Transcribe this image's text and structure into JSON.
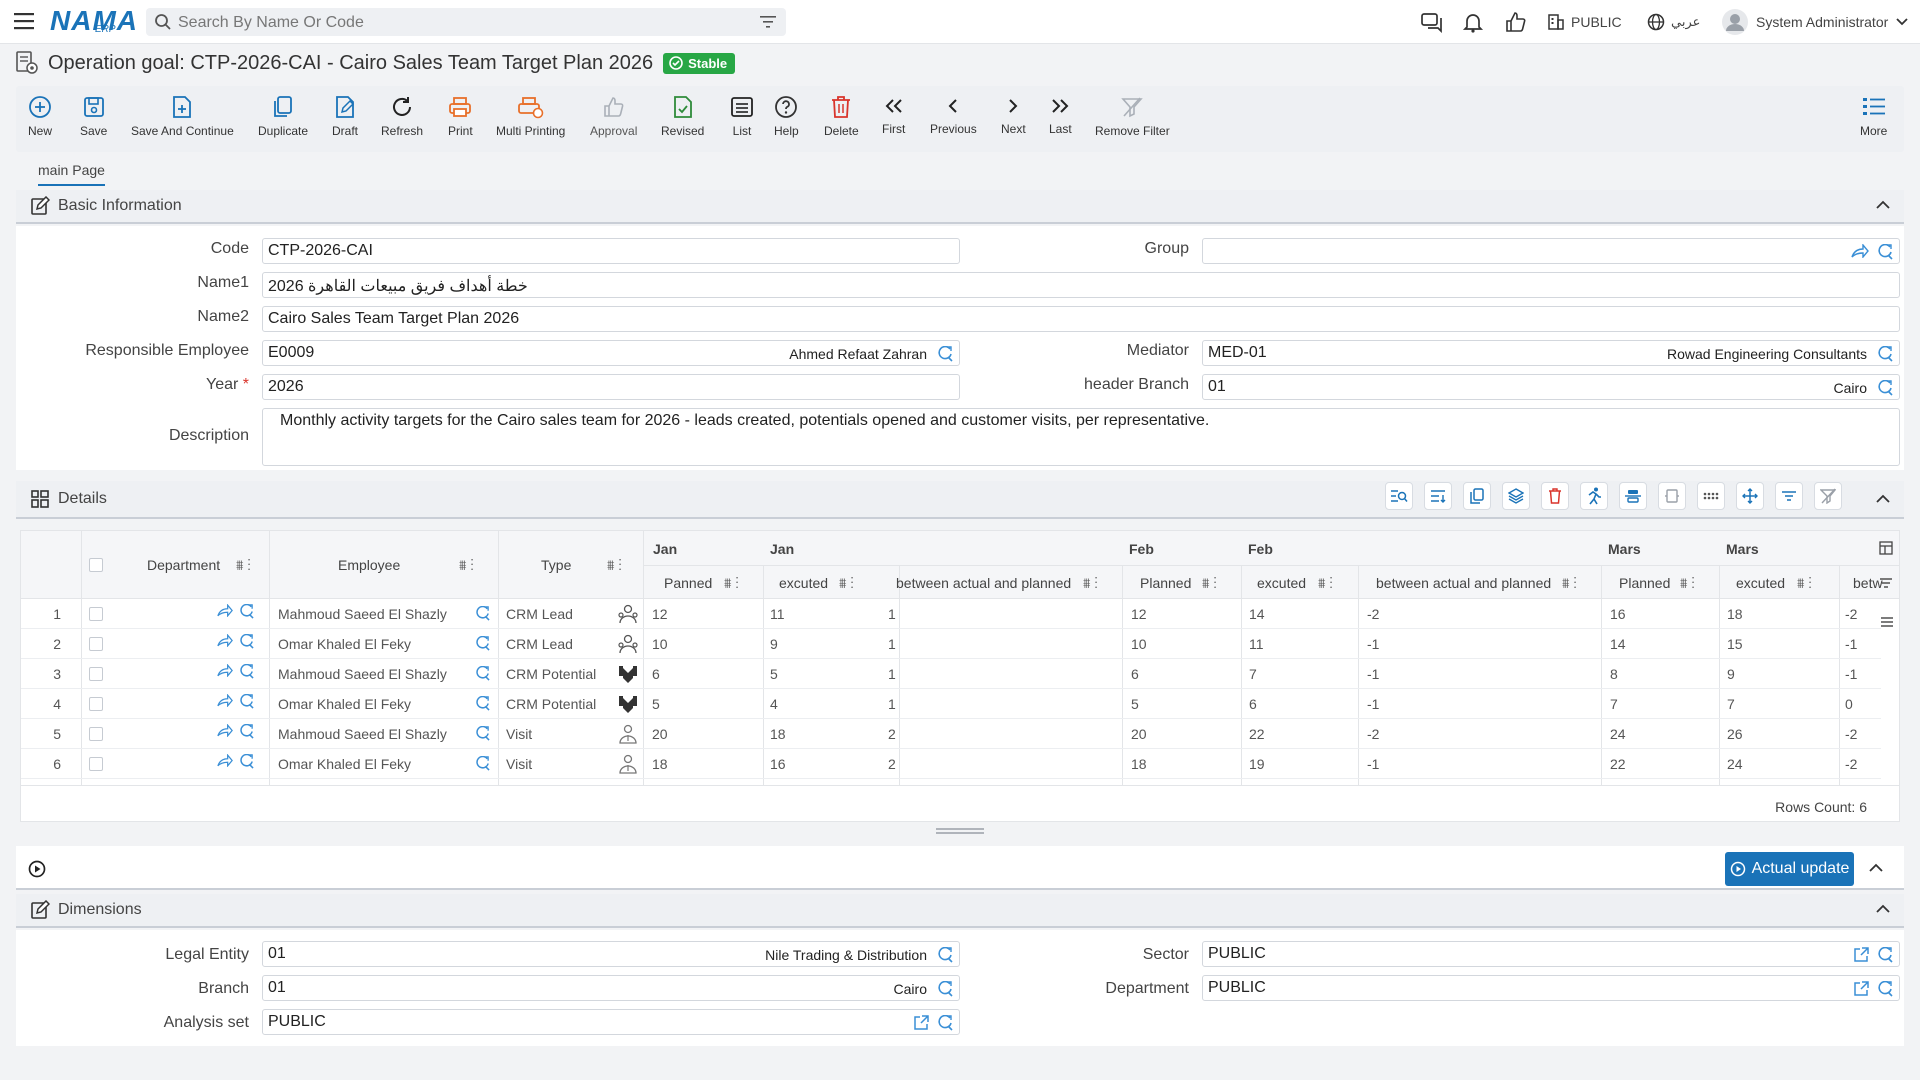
{
  "app": {
    "logo_text": "NAMA",
    "logo_sub": "ERP",
    "search_placeholder": "Search By Name Or Code",
    "public_label": "PUBLIC",
    "language_label": "عربي",
    "user_name": "System Administrator"
  },
  "page": {
    "title": "Operation goal: CTP-2026-CAI - Cairo Sales Team Target Plan 2026",
    "status": "Stable",
    "status_color": "#28a745"
  },
  "toolbar": {
    "new": "New",
    "save": "Save",
    "save_continue": "Save And Continue",
    "duplicate": "Duplicate",
    "draft": "Draft",
    "refresh": "Refresh",
    "print": "Print",
    "multi_printing": "Multi Printing",
    "approval": "Approval",
    "revised": "Revised",
    "list": "List",
    "help": "Help",
    "delete": "Delete",
    "first": "First",
    "previous": "Previous",
    "next": "Next",
    "last": "Last",
    "remove_filter": "Remove Filter",
    "more": "More"
  },
  "tabs": {
    "main": "main Page"
  },
  "basic": {
    "section_title": "Basic Information",
    "code_label": "Code",
    "code": "CTP-2026-CAI",
    "group_label": "Group",
    "group": "",
    "name1_label": "Name1",
    "name1": "خطة أهداف فريق مبيعات القاهرة 2026",
    "name2_label": "Name2",
    "name2": "Cairo Sales Team Target Plan 2026",
    "resp_label": "Responsible Employee",
    "resp_code": "E0009",
    "resp_name": "Ahmed Refaat Zahran",
    "mediator_label": "Mediator",
    "mediator_code": "MED-01",
    "mediator_name": "Rowad Engineering Consultants",
    "year_label": "Year",
    "year": "2026",
    "branch_label": "header Branch",
    "branch_code": "01",
    "branch_name": "Cairo",
    "desc_label": "Description",
    "description": "Monthly activity targets for the Cairo sales team for 2026 - leads created, potentials opened and customer visits, per representative."
  },
  "details": {
    "section_title": "Details",
    "headers": {
      "department": "Department",
      "employee": "Employee",
      "type": "Type",
      "jan": "Jan",
      "feb": "Feb",
      "mars": "Mars",
      "jan_planned": "Panned",
      "planned": "Planned",
      "excuted": "excuted",
      "diff": "between actual and planned",
      "diff_cut": "betw"
    },
    "rows": [
      {
        "n": "1",
        "employee": "Mahmoud Saeed El Shazly",
        "type": "CRM Lead",
        "icon": "lead-icon",
        "jp": "12",
        "je": "11",
        "jd": "1",
        "fp": "12",
        "fe": "14",
        "fd": "-2",
        "mp": "16",
        "me": "18",
        "md": "-2"
      },
      {
        "n": "2",
        "employee": "Omar Khaled El Feky",
        "type": "CRM Lead",
        "icon": "lead-icon",
        "jp": "10",
        "je": "9",
        "jd": "1",
        "fp": "10",
        "fe": "11",
        "fd": "-1",
        "mp": "14",
        "me": "15",
        "md": "-1"
      },
      {
        "n": "3",
        "employee": "Mahmoud Saeed El Shazly",
        "type": "CRM Potential",
        "icon": "potential-icon",
        "jp": "6",
        "je": "5",
        "jd": "1",
        "fp": "6",
        "fe": "7",
        "fd": "-1",
        "mp": "8",
        "me": "9",
        "md": "-1"
      },
      {
        "n": "4",
        "employee": "Omar Khaled El Feky",
        "type": "CRM Potential",
        "icon": "potential-icon",
        "jp": "5",
        "je": "4",
        "jd": "1",
        "fp": "5",
        "fe": "6",
        "fd": "-1",
        "mp": "7",
        "me": "7",
        "md": "0"
      },
      {
        "n": "5",
        "employee": "Mahmoud Saeed El Shazly",
        "type": "Visit",
        "icon": "visit-icon",
        "jp": "20",
        "je": "18",
        "jd": "2",
        "fp": "20",
        "fe": "22",
        "fd": "-2",
        "mp": "24",
        "me": "26",
        "md": "-2"
      },
      {
        "n": "6",
        "employee": "Omar Khaled El Feky",
        "type": "Visit",
        "icon": "visit-icon",
        "jp": "18",
        "je": "16",
        "jd": "2",
        "fp": "18",
        "fe": "19",
        "fd": "-1",
        "mp": "22",
        "me": "24",
        "md": "-2"
      }
    ],
    "rows_count": "Rows Count: 6"
  },
  "actions": {
    "actual_update": "Actual update"
  },
  "dimensions": {
    "section_title": "Dimensions",
    "legal_label": "Legal Entity",
    "legal_code": "01",
    "legal_name": "Nile Trading & Distribution",
    "sector_label": "Sector",
    "sector": "PUBLIC",
    "branch_label": "Branch",
    "branch_code": "01",
    "branch_name": "Cairo",
    "department_label": "Department",
    "department": "PUBLIC",
    "analysis_label": "Analysis set",
    "analysis": "PUBLIC"
  }
}
